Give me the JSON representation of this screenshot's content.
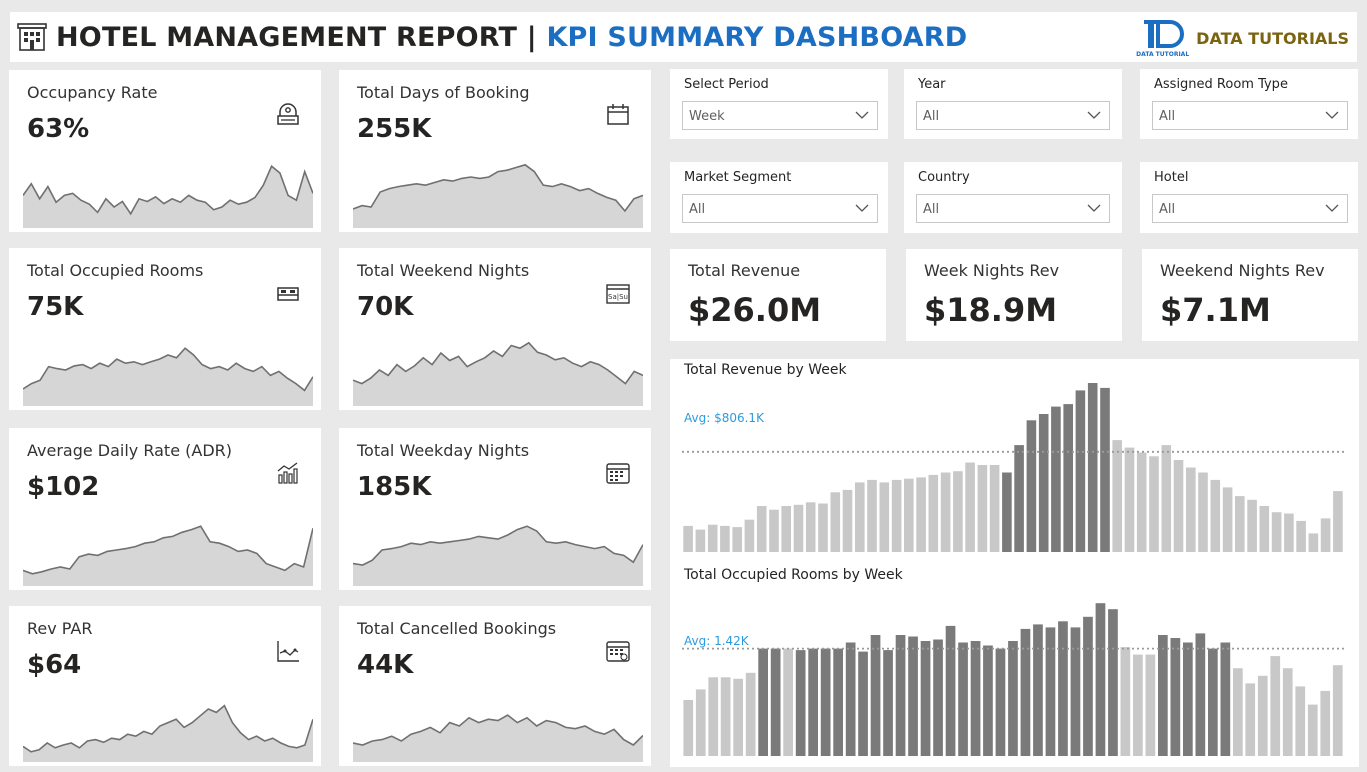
{
  "header": {
    "title": "HOTEL MANAGEMENT REPORT | ",
    "subtitle": "KPI SUMMARY DASHBOARD",
    "brand_logo_text": "DATA TUTORIAL",
    "brand": "DATA TUTORIALS"
  },
  "colors": {
    "accent": "#1b6ec2",
    "brand": "#7a6410",
    "avg_line": "#2b9be0",
    "bar_light": "#c8c8c8",
    "bar_dark": "#7a7a7a",
    "spark_fill": "#d6d6d6",
    "spark_line": "#707070"
  },
  "kpis": [
    {
      "label": "Occupancy Rate",
      "value": "63%",
      "icon": "hotel-reception-icon"
    },
    {
      "label": "Total Days of Booking",
      "value": "255K",
      "icon": "calendar-icon"
    },
    {
      "label": "Total Occupied Rooms",
      "value": "75K",
      "icon": "bed-icon"
    },
    {
      "label": "Total Weekend Nights",
      "value": "70K",
      "icon": "weekend-calendar-icon"
    },
    {
      "label": "Average Daily Rate (ADR)",
      "value": "$102",
      "icon": "growth-chart-icon"
    },
    {
      "label": "Total Weekday Nights",
      "value": "185K",
      "icon": "weekday-calendar-icon"
    },
    {
      "label": "Rev PAR",
      "value": "$64",
      "icon": "line-graph-icon"
    },
    {
      "label": "Total Cancelled Bookings",
      "value": "44K",
      "icon": "cancel-calendar-icon"
    }
  ],
  "slicers": [
    {
      "label": "Select Period",
      "value": "Week"
    },
    {
      "label": "Year",
      "value": "All"
    },
    {
      "label": "Assigned Room Type",
      "value": "All"
    },
    {
      "label": "Market Segment",
      "value": "All"
    },
    {
      "label": "Country",
      "value": "All"
    },
    {
      "label": "Hotel",
      "value": "All"
    }
  ],
  "revenue_cards": [
    {
      "label": "Total Revenue",
      "value": "$26.0M"
    },
    {
      "label": "Week Nights Rev",
      "value": "$18.9M"
    },
    {
      "label": "Weekend Nights Rev",
      "value": "$7.1M"
    }
  ],
  "chart_data": [
    {
      "type": "bar",
      "title": "Total Revenue by Week",
      "avg_label": "Avg: $806.1K",
      "avg": 806.1,
      "unit": "K",
      "ylim": [
        0,
        1400
      ],
      "values": [
        210,
        180,
        220,
        210,
        200,
        260,
        370,
        340,
        370,
        380,
        400,
        390,
        480,
        500,
        560,
        580,
        560,
        580,
        590,
        600,
        620,
        640,
        650,
        720,
        700,
        700,
        640,
        860,
        1060,
        1110,
        1170,
        1190,
        1300,
        1360,
        1320,
        900,
        840,
        800,
        770,
        860,
        740,
        680,
        640,
        580,
        520,
        450,
        420,
        370,
        320,
        310,
        250,
        150,
        270,
        490
      ],
      "highlight": [
        26,
        27,
        28,
        29,
        30,
        31,
        32,
        33,
        34
      ]
    },
    {
      "type": "bar",
      "title": "Total Occupied Rooms by Week",
      "avg_label": "Avg: 1.42K",
      "avg": 1.42,
      "unit": "K",
      "ylim": [
        0,
        2.3
      ],
      "values": [
        0.74,
        0.88,
        1.04,
        1.04,
        1.02,
        1.1,
        1.42,
        1.42,
        1.42,
        1.4,
        1.42,
        1.42,
        1.42,
        1.5,
        1.38,
        1.6,
        1.4,
        1.6,
        1.58,
        1.52,
        1.54,
        1.72,
        1.5,
        1.52,
        1.46,
        1.42,
        1.52,
        1.68,
        1.74,
        1.7,
        1.78,
        1.7,
        1.84,
        2.02,
        1.94,
        1.44,
        1.34,
        1.34,
        1.6,
        1.56,
        1.5,
        1.62,
        1.42,
        1.5,
        1.16,
        0.96,
        1.06,
        1.32,
        1.16,
        0.92,
        0.68,
        0.86,
        1.2
      ],
      "highlight": [
        6,
        7,
        9,
        10,
        11,
        12,
        13,
        14,
        15,
        16,
        17,
        18,
        19,
        20,
        21,
        22,
        23,
        24,
        25,
        26,
        27,
        28,
        29,
        30,
        31,
        32,
        33,
        34,
        38,
        39,
        40,
        41,
        42,
        43
      ]
    }
  ],
  "sparklines": [
    [
      0.45,
      0.62,
      0.4,
      0.58,
      0.35,
      0.45,
      0.48,
      0.38,
      0.32,
      0.2,
      0.4,
      0.28,
      0.36,
      0.18,
      0.4,
      0.36,
      0.43,
      0.33,
      0.4,
      0.35,
      0.45,
      0.38,
      0.35,
      0.24,
      0.28,
      0.38,
      0.32,
      0.35,
      0.42,
      0.6,
      0.88,
      0.78,
      0.45,
      0.38,
      0.8,
      0.48
    ],
    [
      0.25,
      0.3,
      0.28,
      0.5,
      0.55,
      0.58,
      0.6,
      0.62,
      0.6,
      0.64,
      0.68,
      0.66,
      0.7,
      0.72,
      0.7,
      0.72,
      0.8,
      0.82,
      0.86,
      0.9,
      0.8,
      0.6,
      0.58,
      0.62,
      0.58,
      0.52,
      0.55,
      0.48,
      0.42,
      0.38,
      0.22,
      0.4,
      0.45
    ],
    [
      0.22,
      0.3,
      0.35,
      0.55,
      0.52,
      0.5,
      0.56,
      0.58,
      0.52,
      0.6,
      0.55,
      0.66,
      0.6,
      0.62,
      0.58,
      0.62,
      0.66,
      0.72,
      0.68,
      0.82,
      0.72,
      0.58,
      0.52,
      0.55,
      0.5,
      0.6,
      0.52,
      0.48,
      0.55,
      0.42,
      0.48,
      0.38,
      0.3,
      0.2,
      0.4
    ],
    [
      0.35,
      0.3,
      0.38,
      0.5,
      0.42,
      0.58,
      0.48,
      0.56,
      0.68,
      0.58,
      0.75,
      0.64,
      0.7,
      0.55,
      0.62,
      0.68,
      0.78,
      0.7,
      0.86,
      0.82,
      0.9,
      0.76,
      0.72,
      0.65,
      0.68,
      0.6,
      0.55,
      0.62,
      0.58,
      0.5,
      0.4,
      0.3,
      0.48,
      0.42
    ],
    [
      0.2,
      0.15,
      0.18,
      0.22,
      0.25,
      0.22,
      0.4,
      0.44,
      0.42,
      0.48,
      0.5,
      0.52,
      0.55,
      0.6,
      0.62,
      0.68,
      0.7,
      0.76,
      0.8,
      0.85,
      0.62,
      0.6,
      0.55,
      0.48,
      0.5,
      0.45,
      0.3,
      0.25,
      0.2,
      0.3,
      0.25,
      0.82
    ],
    [
      0.3,
      0.28,
      0.35,
      0.5,
      0.52,
      0.55,
      0.6,
      0.58,
      0.62,
      0.6,
      0.62,
      0.64,
      0.66,
      0.7,
      0.68,
      0.66,
      0.72,
      0.8,
      0.85,
      0.78,
      0.62,
      0.6,
      0.62,
      0.58,
      0.55,
      0.52,
      0.55,
      0.45,
      0.42,
      0.32,
      0.58
    ],
    [
      0.2,
      0.12,
      0.15,
      0.25,
      0.18,
      0.22,
      0.25,
      0.18,
      0.28,
      0.3,
      0.26,
      0.32,
      0.3,
      0.38,
      0.35,
      0.42,
      0.38,
      0.5,
      0.55,
      0.6,
      0.48,
      0.55,
      0.65,
      0.75,
      0.7,
      0.8,
      0.55,
      0.4,
      0.3,
      0.35,
      0.28,
      0.32,
      0.25,
      0.2,
      0.18,
      0.22,
      0.6
    ],
    [
      0.25,
      0.22,
      0.28,
      0.3,
      0.35,
      0.28,
      0.38,
      0.42,
      0.48,
      0.4,
      0.55,
      0.5,
      0.62,
      0.55,
      0.6,
      0.58,
      0.66,
      0.55,
      0.62,
      0.5,
      0.58,
      0.55,
      0.48,
      0.46,
      0.5,
      0.42,
      0.38,
      0.45,
      0.3,
      0.22,
      0.36
    ]
  ]
}
